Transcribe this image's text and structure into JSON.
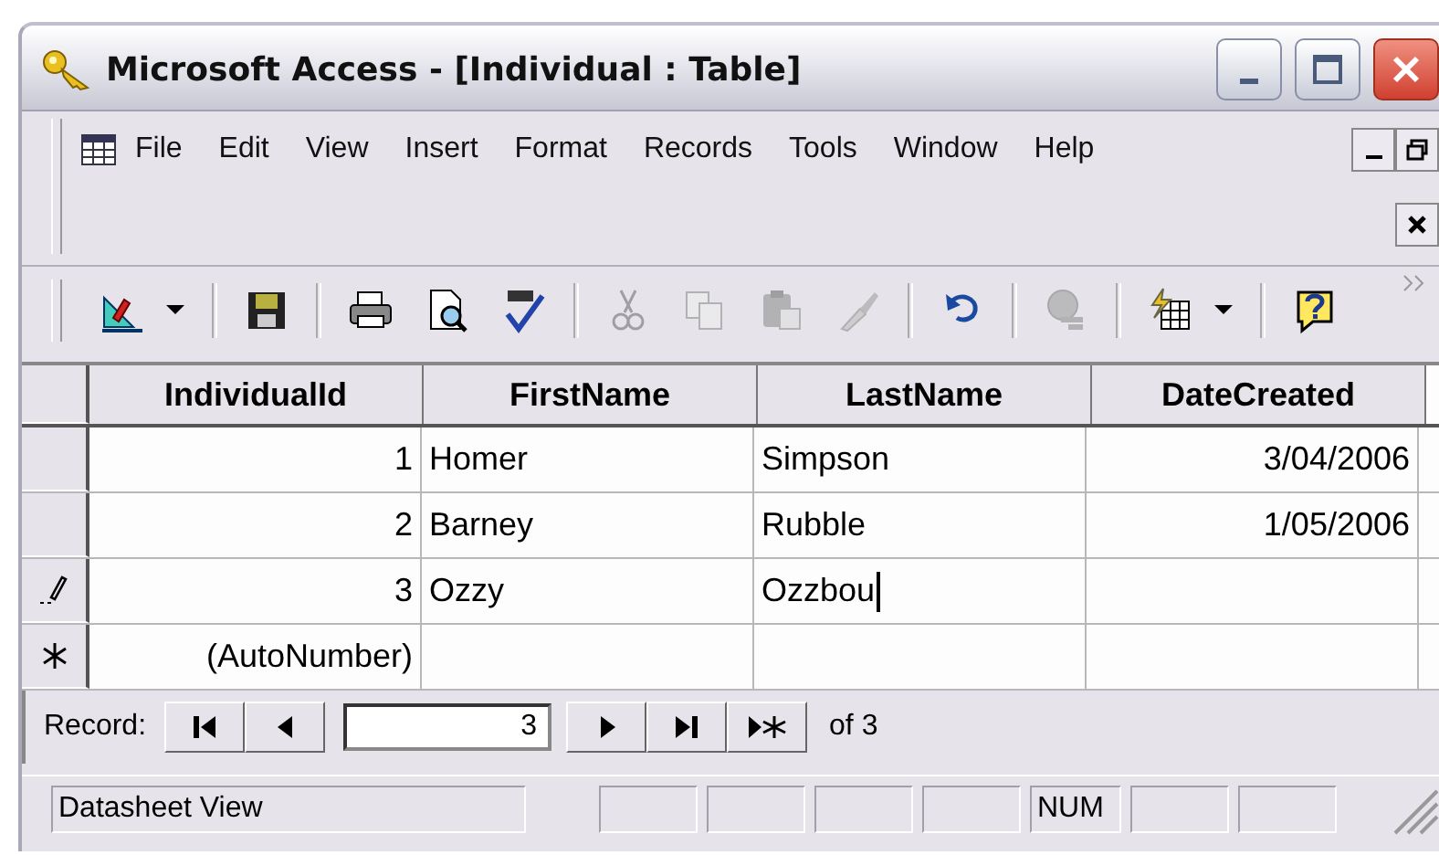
{
  "window": {
    "title": "Microsoft Access - [Individual : Table]"
  },
  "menu_bar": {
    "items": [
      "File",
      "Edit",
      "View",
      "Insert",
      "Format",
      "Records",
      "Tools",
      "Window",
      "Help"
    ]
  },
  "toolbar": {
    "items": [
      {
        "kind": "design",
        "disabled": false
      },
      {
        "kind": "dropdown"
      },
      {
        "kind": "save",
        "disabled": false
      },
      {
        "kind": "print",
        "disabled": false
      },
      {
        "kind": "preview",
        "disabled": false
      },
      {
        "kind": "spelling",
        "disabled": false
      },
      {
        "kind": "cut",
        "disabled": true
      },
      {
        "kind": "copy",
        "disabled": true
      },
      {
        "kind": "paste",
        "disabled": true
      },
      {
        "kind": "painter",
        "disabled": true
      },
      {
        "kind": "undo",
        "disabled": false
      },
      {
        "kind": "hyperlink",
        "disabled": true
      },
      {
        "kind": "new-object",
        "disabled": false
      },
      {
        "kind": "dropdown"
      },
      {
        "kind": "help",
        "disabled": false
      }
    ]
  },
  "table": {
    "columns": [
      {
        "name": "IndividualId",
        "kind": "number"
      },
      {
        "name": "FirstName",
        "kind": "text"
      },
      {
        "name": "LastName",
        "kind": "text"
      },
      {
        "name": "DateCreated",
        "kind": "date"
      }
    ],
    "rows": [
      {
        "kind": "record",
        "cells": [
          {
            "text": "1",
            "caret": false
          },
          {
            "text": "Homer",
            "caret": false
          },
          {
            "text": "Simpson",
            "caret": false
          },
          {
            "text": "3/04/2006",
            "caret": false
          }
        ]
      },
      {
        "kind": "record",
        "cells": [
          {
            "text": "2",
            "caret": false
          },
          {
            "text": "Barney",
            "caret": false
          },
          {
            "text": "Rubble",
            "caret": false
          },
          {
            "text": "1/05/2006",
            "caret": false
          }
        ]
      },
      {
        "kind": "editing",
        "cells": [
          {
            "text": "3",
            "caret": false
          },
          {
            "text": "Ozzy",
            "caret": false
          },
          {
            "text": "Ozzbou",
            "caret": true
          },
          {
            "text": "",
            "caret": false
          }
        ]
      },
      {
        "kind": "new",
        "cells": [
          {
            "text": "(AutoNumber)",
            "caret": false
          },
          {
            "text": "",
            "caret": false
          },
          {
            "text": "",
            "caret": false
          },
          {
            "text": "",
            "caret": false
          }
        ]
      }
    ]
  },
  "record_navigator": {
    "label": "Record:",
    "current": "3",
    "total": "of 3"
  },
  "status_bar": {
    "message": "Datasheet View",
    "indicators": [
      "NUM"
    ]
  }
}
